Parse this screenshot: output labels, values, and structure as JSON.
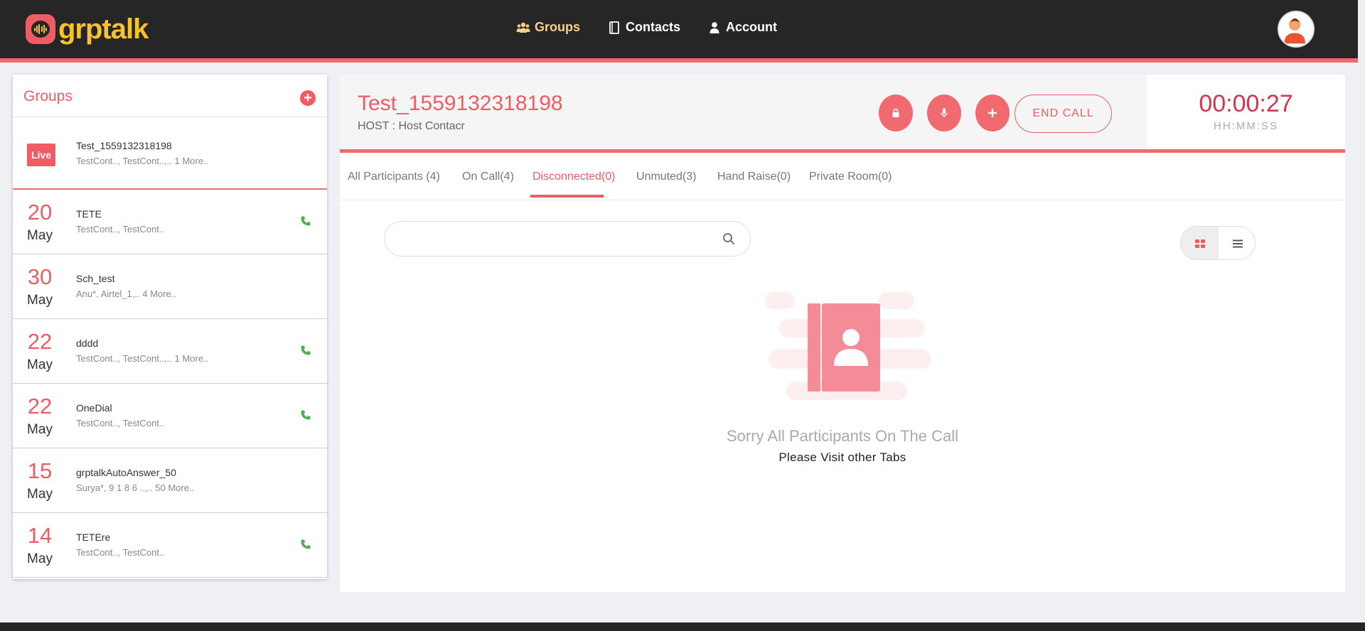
{
  "brand": {
    "name": "grptalk"
  },
  "nav": {
    "items": [
      {
        "label": "Groups",
        "icon": "groups-icon",
        "active": true
      },
      {
        "label": "Contacts",
        "icon": "contacts-book-icon",
        "active": false
      },
      {
        "label": "Account",
        "icon": "user-icon",
        "active": false
      }
    ]
  },
  "groups_panel": {
    "title": "Groups",
    "add_icon": "plus-circle-icon",
    "items": [
      {
        "badge": "Live",
        "name": "Test_1559132318198",
        "members": "TestCont.., TestCont..,.. 1 More..",
        "phone": false
      },
      {
        "day": "20",
        "month": "May",
        "name": "TETE",
        "members": "TestCont.., TestCont..",
        "phone": true
      },
      {
        "day": "30",
        "month": "May",
        "name": "Sch_test",
        "members": "Anu*, Airtel_1,.. 4 More..",
        "phone": false
      },
      {
        "day": "22",
        "month": "May",
        "name": "dddd",
        "members": "TestCont.., TestCont..,.. 1 More..",
        "phone": true
      },
      {
        "day": "22",
        "month": "May",
        "name": "OneDial",
        "members": "TestCont.., TestCont..",
        "phone": true
      },
      {
        "day": "15",
        "month": "May",
        "name": "grptalkAutoAnswer_50",
        "members": "Surya*, 9 1 8 6 ..,.. 50 More..",
        "phone": false
      },
      {
        "day": "14",
        "month": "May",
        "name": "TETEre",
        "members": "TestCont.., TestCont..",
        "phone": true
      }
    ]
  },
  "call": {
    "title": "Test_1559132318198",
    "host": "HOST : Host Contacr",
    "actions": [
      "lock-icon",
      "microphone-icon",
      "plus-icon"
    ],
    "end_call_label": "END CALL",
    "timer": "00:00:27",
    "timer_label": "HH:MM:SS"
  },
  "tabs": [
    {
      "label": "All Participants (4)",
      "active": false
    },
    {
      "label": "On Call(4)",
      "active": false
    },
    {
      "label": "Disconnected(0)",
      "active": true
    },
    {
      "label": "Unmuted(3)",
      "active": false
    },
    {
      "label": "Hand Raise(0)",
      "active": false
    },
    {
      "label": "Private Room(0)",
      "active": false
    }
  ],
  "search": {
    "placeholder": "",
    "value": ""
  },
  "empty_state": {
    "title": "Sorry All Participants On The Call",
    "subtitle": "Please Visit other Tabs"
  },
  "colors": {
    "accent": "#ef5c64",
    "brand_yellow": "#f6c22e",
    "topbar": "#262626",
    "call_green": "#4caf50"
  }
}
